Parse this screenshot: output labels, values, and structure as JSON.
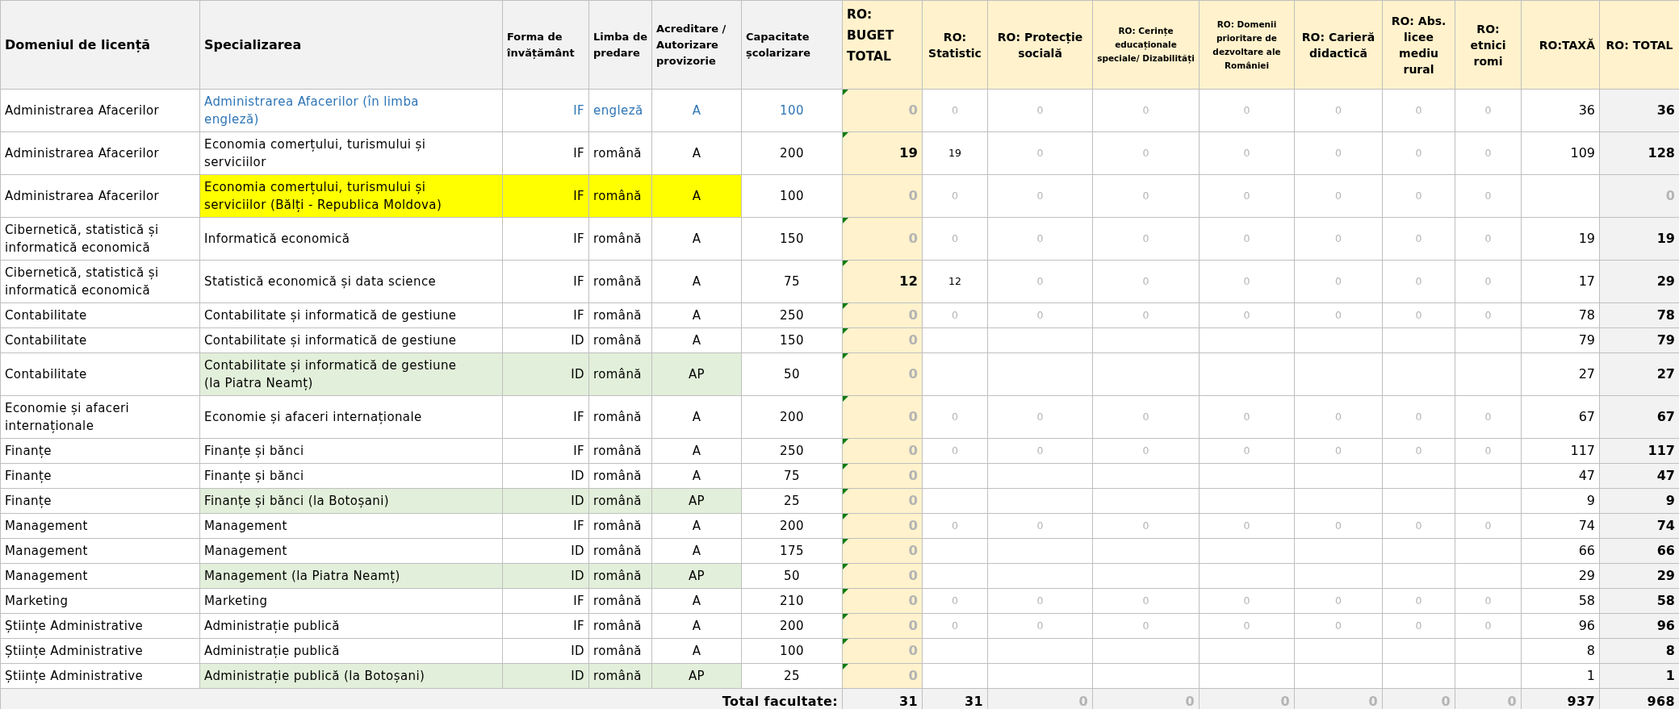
{
  "table": {
    "columns": [
      {
        "label": "Domeniul de licență",
        "kind": "main"
      },
      {
        "label": "Specializarea",
        "kind": "main"
      },
      {
        "label": "Forma de învățământ",
        "kind": "small"
      },
      {
        "label": "Limba de predare",
        "kind": "small"
      },
      {
        "label": "Acreditare / Autorizare provizorie",
        "kind": "small"
      },
      {
        "label": "Capacitate școlarizare",
        "kind": "small"
      },
      {
        "label": "RO: BUGET TOTAL",
        "kind": "budget"
      },
      {
        "label": "RO: Statistic",
        "kind": "quota"
      },
      {
        "label": "RO: Protecție socială",
        "kind": "quota"
      },
      {
        "label": "RO: Cerințe educaționale speciale/ Dizabilități",
        "kind": "tiny"
      },
      {
        "label": "RO: Domenii prioritare de dezvoltare ale României",
        "kind": "tiny"
      },
      {
        "label": "RO: Carieră didactică",
        "kind": "quota"
      },
      {
        "label": "RO: Abs. licee mediu rural",
        "kind": "quota"
      },
      {
        "label": "RO: etnici romi",
        "kind": "quota"
      },
      {
        "label": "RO:TAXĂ",
        "kind": "fee"
      },
      {
        "label": "RO: TOTAL",
        "kind": "quota"
      }
    ],
    "rows": [
      {
        "domain": "Administrarea Afacerilor",
        "specialization": "Administrarea Afacerilor (în limba engleză)",
        "form": "IF",
        "language": "engleză",
        "accreditation": "A",
        "capacity": "100",
        "accent": true,
        "budget": {
          "text": "0",
          "muted": true,
          "flagged": true
        },
        "statistic": {
          "text": "0",
          "muted": true
        },
        "quotas": [
          "0",
          "0",
          "0",
          "0",
          "0",
          "0"
        ],
        "fee": "36",
        "total": {
          "text": "36",
          "muted": false
        }
      },
      {
        "domain": "Administrarea Afacerilor",
        "specialization": "Economia comerțului, turismului și serviciilor",
        "form": "IF",
        "language": "română",
        "accreditation": "A",
        "capacity": "200",
        "budget": {
          "text": "19",
          "muted": false,
          "flagged": true
        },
        "statistic": {
          "text": "19",
          "muted": false
        },
        "quotas": [
          "0",
          "0",
          "0",
          "0",
          "0",
          "0"
        ],
        "fee": "109",
        "total": {
          "text": "128",
          "muted": false
        }
      },
      {
        "domain": "Administrarea Afacerilor",
        "specialization": "Economia comerțului, turismului și serviciilor (Bălți - Republica Moldova)",
        "form": "IF",
        "language": "română",
        "accreditation": "A",
        "capacity": "100",
        "color": "#ffff00",
        "budget": {
          "text": "0",
          "muted": true,
          "flagged": false
        },
        "statistic": {
          "text": "0",
          "muted": true
        },
        "quotas": [
          "0",
          "0",
          "0",
          "0",
          "0",
          "0"
        ],
        "total": {
          "text": "0",
          "muted": true
        }
      },
      {
        "domain": "Cibernetică, statistică și informatică economică",
        "specialization": "Informatică economică",
        "form": "IF",
        "language": "română",
        "accreditation": "A",
        "capacity": "150",
        "budget": {
          "text": "0",
          "muted": true,
          "flagged": true
        },
        "statistic": {
          "text": "0",
          "muted": true
        },
        "quotas": [
          "0",
          "0",
          "0",
          "0",
          "0",
          "0"
        ],
        "fee": "19",
        "total": {
          "text": "19",
          "muted": false
        }
      },
      {
        "domain": "Cibernetică, statistică și informatică economică",
        "specialization": "Statistică economică și data science",
        "form": "IF",
        "language": "română",
        "accreditation": "A",
        "capacity": "75",
        "budget": {
          "text": "12",
          "muted": false,
          "flagged": true
        },
        "statistic": {
          "text": "12",
          "muted": false
        },
        "quotas": [
          "0",
          "0",
          "0",
          "0",
          "0",
          "0"
        ],
        "fee": "17",
        "total": {
          "text": "29",
          "muted": false
        }
      },
      {
        "domain": "Contabilitate",
        "specialization": "Contabilitate și informatică de gestiune",
        "form": "IF",
        "language": "română",
        "accreditation": "A",
        "capacity": "250",
        "budget": {
          "text": "0",
          "muted": true,
          "flagged": true
        },
        "statistic": {
          "text": "0",
          "muted": true
        },
        "quotas": [
          "0",
          "0",
          "0",
          "0",
          "0",
          "0"
        ],
        "fee": "78",
        "total": {
          "text": "78",
          "muted": false
        }
      },
      {
        "domain": "Contabilitate",
        "specialization": "Contabilitate și informatică de gestiune",
        "form": "ID",
        "language": "română",
        "accreditation": "A",
        "capacity": "150",
        "budget": {
          "text": "0",
          "muted": true,
          "flagged": true
        },
        "quotas": [],
        "fee": "79",
        "total": {
          "text": "79",
          "muted": false
        }
      },
      {
        "domain": "Contabilitate",
        "specialization": "Contabilitate și informatică de gestiune (la Piatra Neamț)",
        "form": "ID",
        "language": "română",
        "accreditation": "AP",
        "capacity": "50",
        "color": "#e2efda",
        "budget": {
          "text": "0",
          "muted": true,
          "flagged": true
        },
        "quotas": [],
        "fee": "27",
        "total": {
          "text": "27",
          "muted": false
        }
      },
      {
        "domain": "Economie și afaceri internaționale",
        "specialization": "Economie și afaceri internaționale",
        "form": "IF",
        "language": "română",
        "accreditation": "A",
        "capacity": "200",
        "budget": {
          "text": "0",
          "muted": true,
          "flagged": true
        },
        "statistic": {
          "text": "0",
          "muted": true
        },
        "quotas": [
          "0",
          "0",
          "0",
          "0",
          "0",
          "0"
        ],
        "fee": "67",
        "total": {
          "text": "67",
          "muted": false
        }
      },
      {
        "domain": "Finanțe",
        "specialization": "Finanțe și bănci",
        "form": "IF",
        "language": "română",
        "accreditation": "A",
        "capacity": "250",
        "budget": {
          "text": "0",
          "muted": true,
          "flagged": true
        },
        "statistic": {
          "text": "0",
          "muted": true
        },
        "quotas": [
          "0",
          "0",
          "0",
          "0",
          "0",
          "0"
        ],
        "fee": "117",
        "total": {
          "text": "117",
          "muted": false
        }
      },
      {
        "domain": "Finanțe",
        "specialization": "Finanțe și bănci",
        "form": "ID",
        "language": "română",
        "accreditation": "A",
        "capacity": "75",
        "budget": {
          "text": "0",
          "muted": true,
          "flagged": true
        },
        "quotas": [],
        "fee": "47",
        "total": {
          "text": "47",
          "muted": false
        }
      },
      {
        "domain": "Finanțe",
        "specialization": "Finanțe și bănci (la Botoșani)",
        "form": "ID",
        "language": "română",
        "accreditation": "AP",
        "capacity": "25",
        "color": "#e2efda",
        "budget": {
          "text": "0",
          "muted": true,
          "flagged": true
        },
        "quotas": [],
        "fee": "9",
        "total": {
          "text": "9",
          "muted": false
        }
      },
      {
        "domain": "Management",
        "specialization": "Management",
        "form": "IF",
        "language": "română",
        "accreditation": "A",
        "capacity": "200",
        "budget": {
          "text": "0",
          "muted": true,
          "flagged": true
        },
        "statistic": {
          "text": "0",
          "muted": true
        },
        "quotas": [
          "0",
          "0",
          "0",
          "0",
          "0",
          "0"
        ],
        "fee": "74",
        "total": {
          "text": "74",
          "muted": false
        }
      },
      {
        "domain": "Management",
        "specialization": "Management",
        "form": "ID",
        "language": "română",
        "accreditation": "A",
        "capacity": "175",
        "budget": {
          "text": "0",
          "muted": true,
          "flagged": true
        },
        "quotas": [],
        "fee": "66",
        "total": {
          "text": "66",
          "muted": false
        }
      },
      {
        "domain": "Management",
        "specialization": "Management (la Piatra Neamț)",
        "form": "ID",
        "language": "română",
        "accreditation": "AP",
        "capacity": "50",
        "color": "#e2efda",
        "budget": {
          "text": "0",
          "muted": true,
          "flagged": true
        },
        "quotas": [],
        "fee": "29",
        "total": {
          "text": "29",
          "muted": false
        }
      },
      {
        "domain": "Marketing",
        "specialization": "Marketing",
        "form": "IF",
        "language": "română",
        "accreditation": "A",
        "capacity": "210",
        "budget": {
          "text": "0",
          "muted": true,
          "flagged": true
        },
        "statistic": {
          "text": "0",
          "muted": true
        },
        "quotas": [
          "0",
          "0",
          "0",
          "0",
          "0",
          "0"
        ],
        "fee": "58",
        "total": {
          "text": "58",
          "muted": false
        }
      },
      {
        "domain": "Științe Administrative",
        "specialization": "Administrație publică",
        "form": "IF",
        "language": "română",
        "accreditation": "A",
        "capacity": "200",
        "budget": {
          "text": "0",
          "muted": true,
          "flagged": true
        },
        "statistic": {
          "text": "0",
          "muted": true
        },
        "quotas": [
          "0",
          "0",
          "0",
          "0",
          "0",
          "0"
        ],
        "fee": "96",
        "total": {
          "text": "96",
          "muted": false
        }
      },
      {
        "domain": "Științe Administrative",
        "specialization": "Administrație publică",
        "form": "ID",
        "language": "română",
        "accreditation": "A",
        "capacity": "100",
        "budget": {
          "text": "0",
          "muted": true,
          "flagged": true
        },
        "quotas": [],
        "fee": "8",
        "total": {
          "text": "8",
          "muted": false
        }
      },
      {
        "domain": "Științe Administrative",
        "specialization": "Administrație publică (la Botoșani)",
        "form": "ID",
        "language": "română",
        "accreditation": "AP",
        "capacity": "25",
        "color": "#e2efda",
        "budget": {
          "text": "0",
          "muted": true,
          "flagged": true
        },
        "quotas": [],
        "fee": "1",
        "total": {
          "text": "1",
          "muted": false
        }
      }
    ],
    "total_row": {
      "label": "Total facultate:",
      "values": [
        {
          "text": "31",
          "muted": false
        },
        {
          "text": "31",
          "muted": false
        },
        {
          "text": "0",
          "muted": true
        },
        {
          "text": "0",
          "muted": true
        },
        {
          "text": "0",
          "muted": true
        },
        {
          "text": "0",
          "muted": true
        },
        {
          "text": "0",
          "muted": true
        },
        {
          "text": "0",
          "muted": true
        },
        {
          "text": "937",
          "muted": false
        },
        {
          "text": "968",
          "muted": false
        }
      ]
    }
  }
}
